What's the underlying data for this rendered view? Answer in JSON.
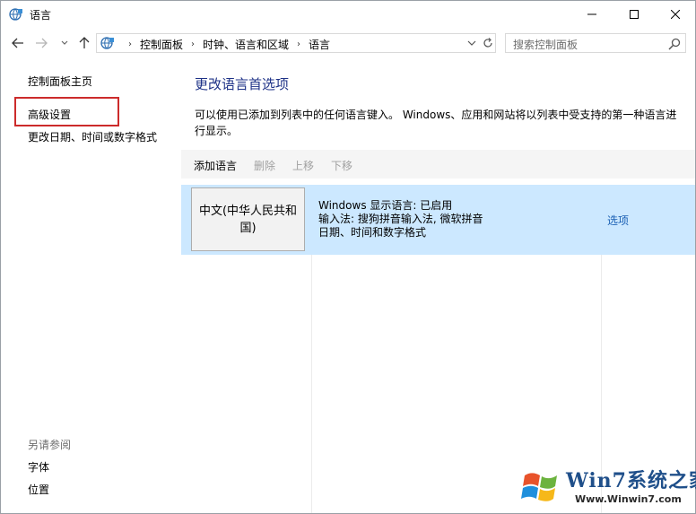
{
  "window": {
    "title": "语言"
  },
  "address": {
    "crumbs": [
      "控制面板",
      "时钟、语言和区域",
      "语言"
    ]
  },
  "search": {
    "placeholder": "搜索控制面板"
  },
  "sidebar": {
    "home": "控制面板主页",
    "advanced": "高级设置",
    "datetime": "更改日期、时间或数字格式",
    "see_also": "另请参阅",
    "fonts": "字体",
    "location": "位置"
  },
  "main": {
    "title": "更改语言首选项",
    "description": "可以使用已添加到列表中的任何语言键入。 Windows、应用和网站将以列表中受支持的第一种语言进行显示。"
  },
  "toolbar": {
    "add": "添加语言",
    "delete": "删除",
    "move_up": "上移",
    "move_down": "下移"
  },
  "languages": [
    {
      "name": "中文(中华人民共和国)",
      "display_language": "Windows 显示语言: 已启用",
      "input_methods": "输入法: 搜狗拼音输入法, 微软拼音",
      "formats": "日期、时间和数字格式",
      "options_label": "选项"
    }
  ],
  "watermark": {
    "brand": "Win7系统之家",
    "url": "Www.Winwin7.com"
  },
  "colors": {
    "accent_title": "#1e3287",
    "selected_row": "#cce8ff",
    "highlight_box": "#cc2b2b",
    "link": "#1a5fb4"
  }
}
